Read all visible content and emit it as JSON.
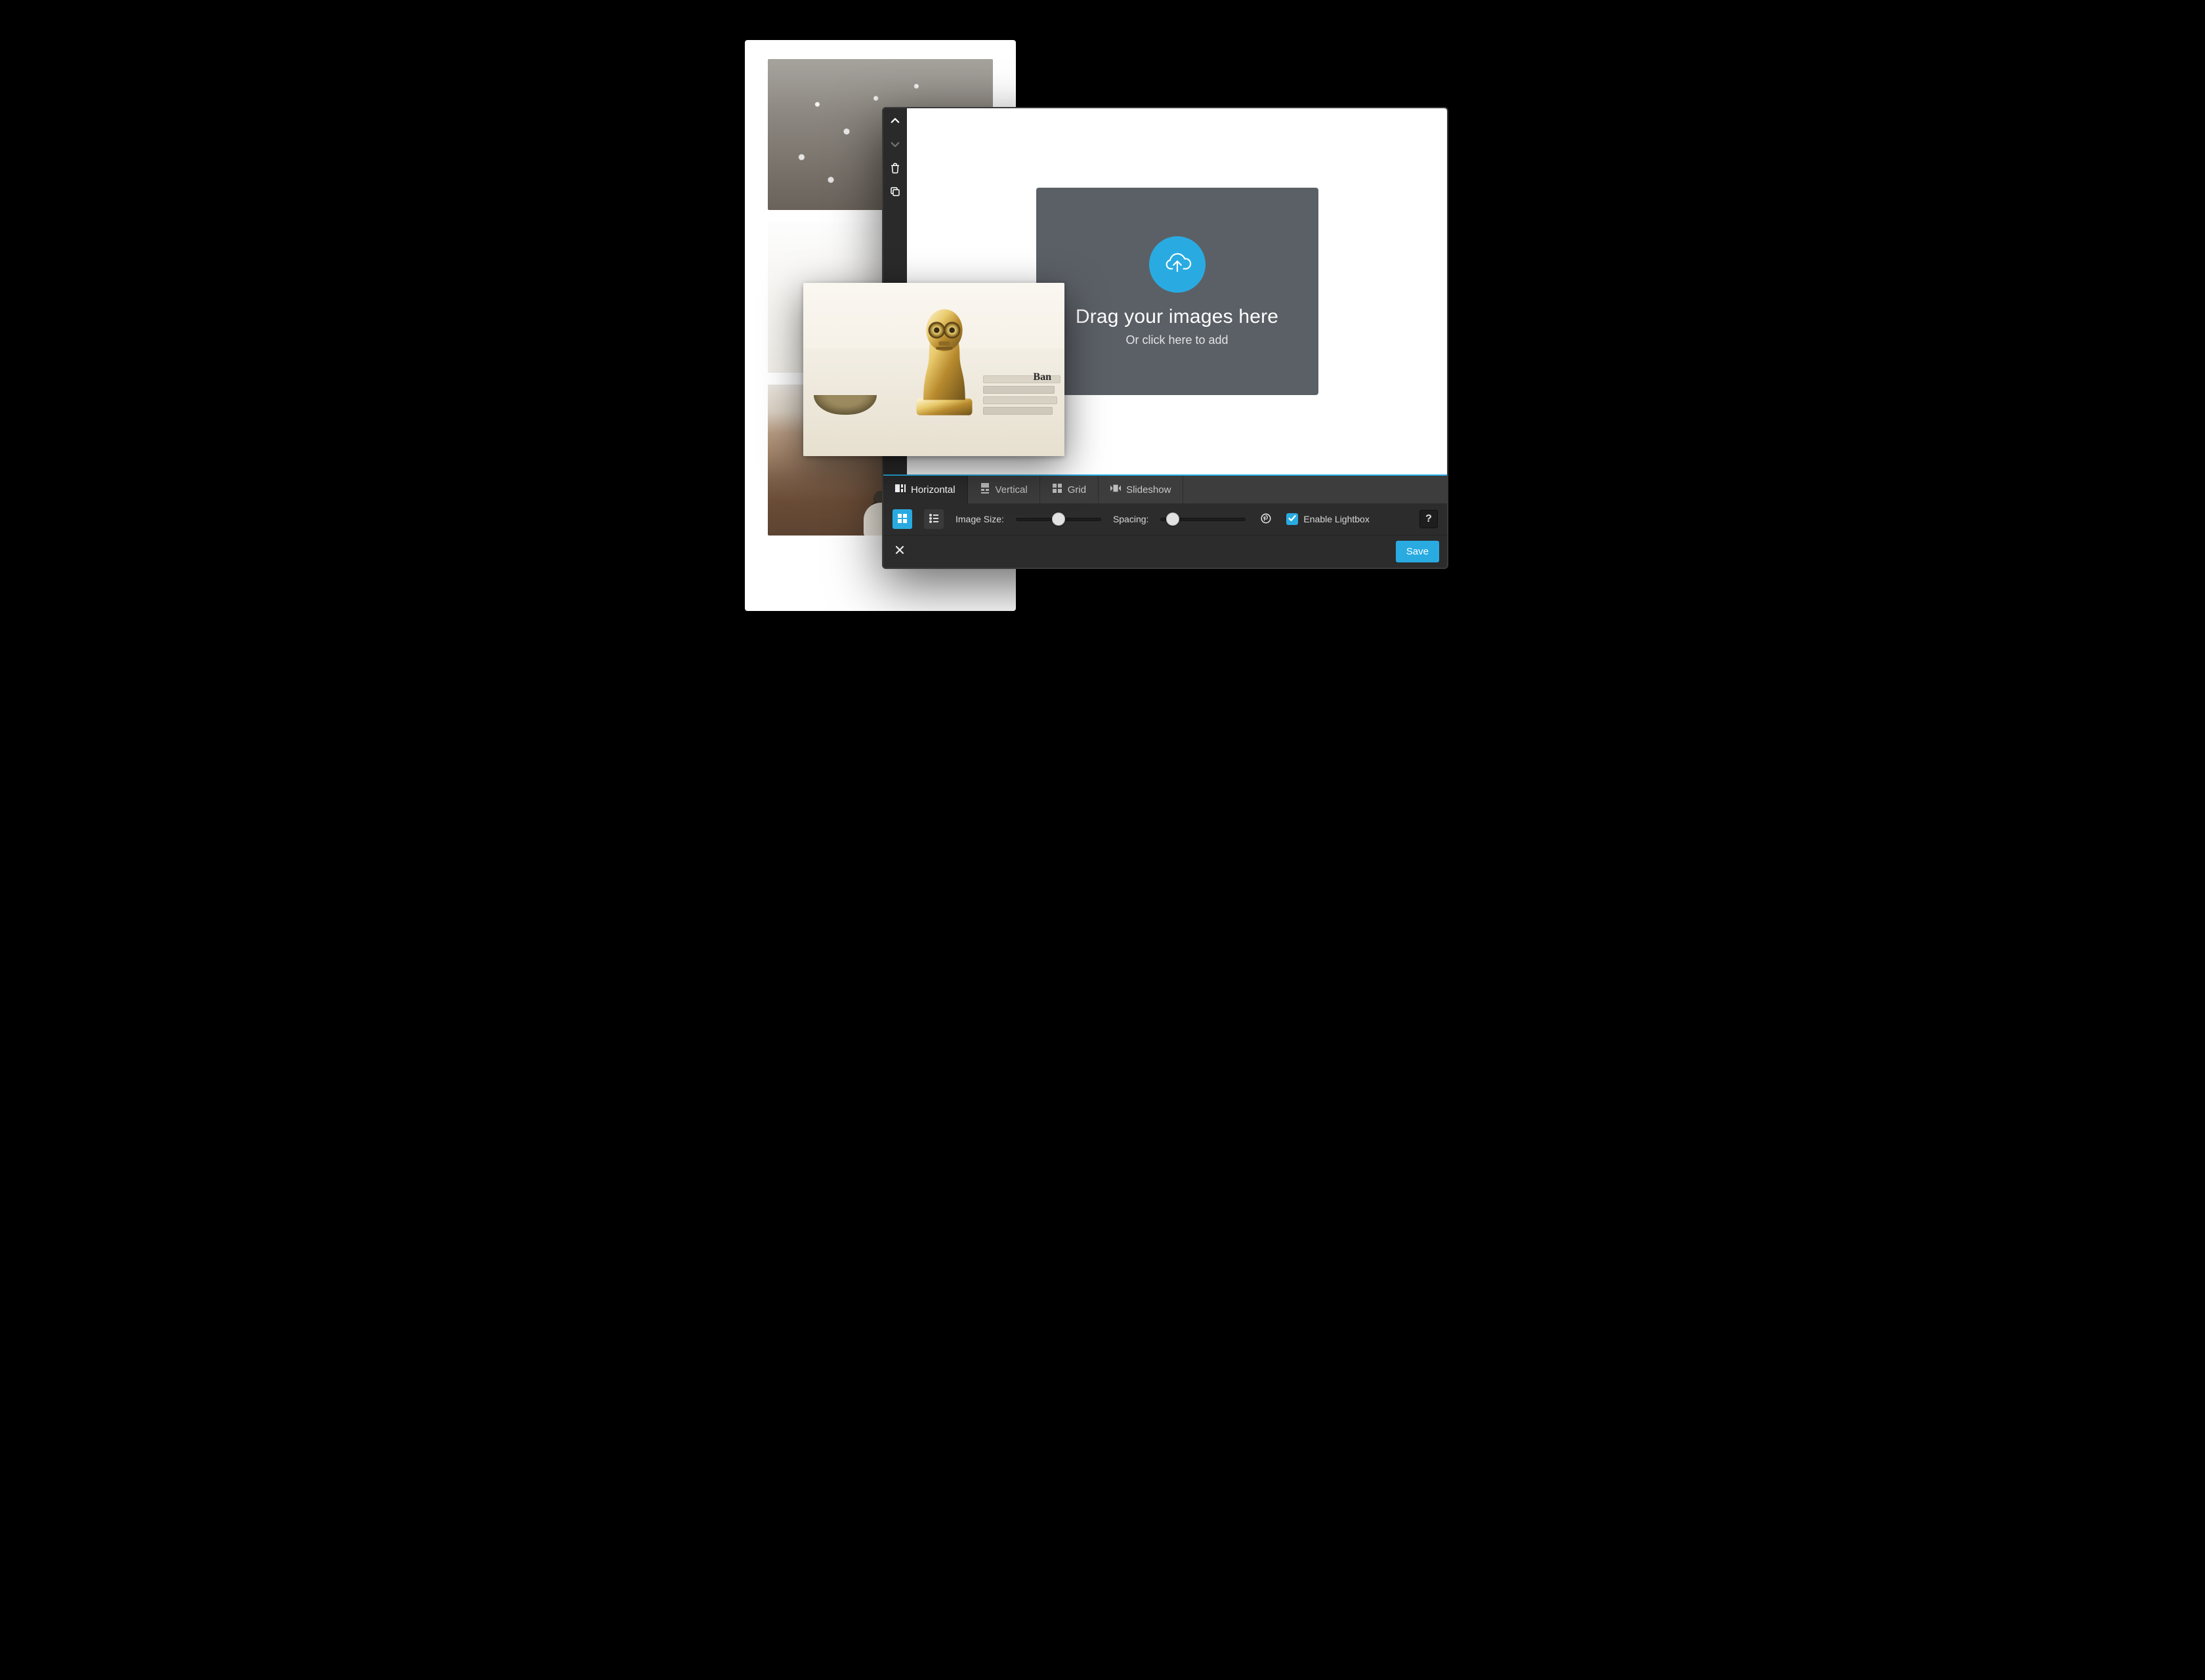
{
  "dropzone": {
    "title": "Drag your images here",
    "subtitle": "Or click here to add"
  },
  "tabs": {
    "horizontal": "Horizontal",
    "vertical": "Vertical",
    "grid": "Grid",
    "slideshow": "Slideshow"
  },
  "options": {
    "image_size_label": "Image Size:",
    "spacing_label": "Spacing:",
    "lightbox_label": "Enable Lightbox",
    "help_label": "?",
    "image_size_value": 50,
    "spacing_value": 12,
    "lightbox_checked": true
  },
  "footer": {
    "save_label": "Save"
  },
  "dragged": {
    "book_spine_text": "Ban"
  },
  "side_tools": {
    "up": "move-up",
    "down": "move-down",
    "delete": "delete",
    "duplicate": "duplicate"
  }
}
